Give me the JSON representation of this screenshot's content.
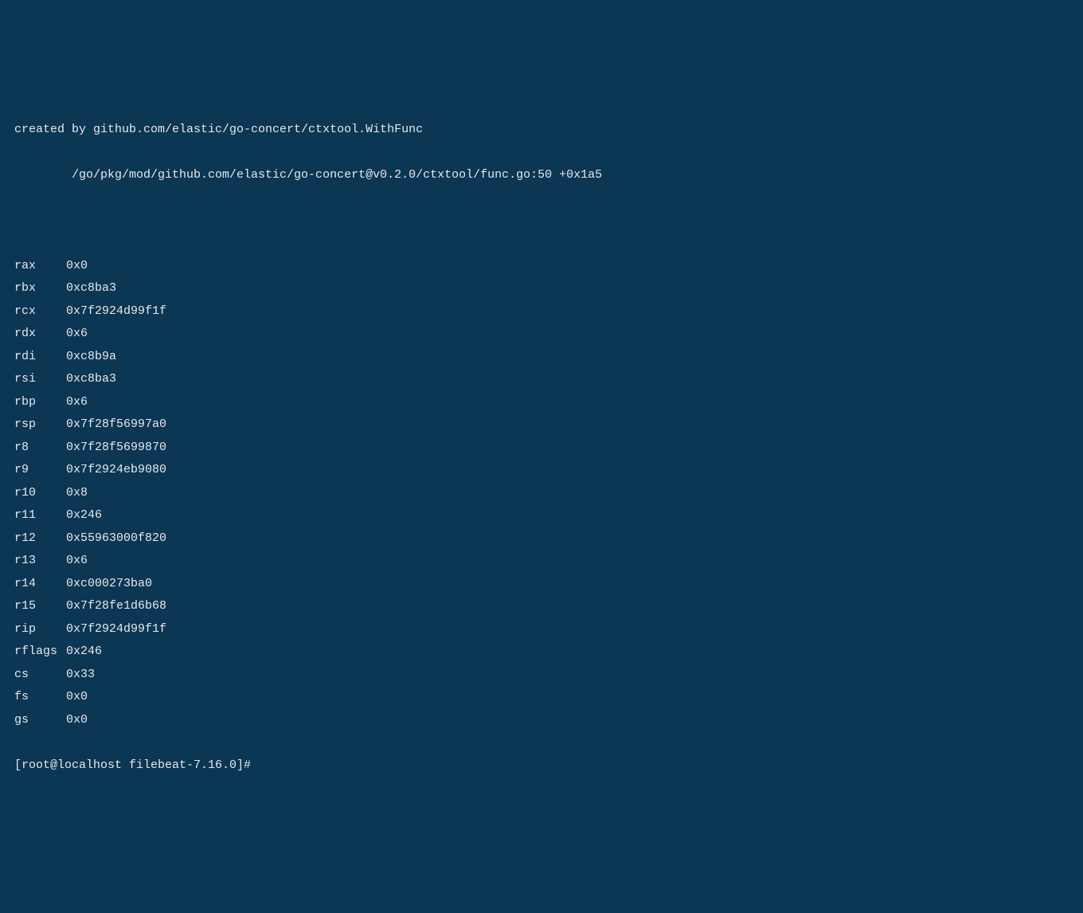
{
  "trace": {
    "line1": "created by github.com/elastic/go-concert/ctxtool.WithFunc",
    "line2": "        /go/pkg/mod/github.com/elastic/go-concert@v0.2.0/ctxtool/func.go:50 +0x1a5"
  },
  "registers": [
    {
      "name": "rax",
      "value": "0x0"
    },
    {
      "name": "rbx",
      "value": "0xc8ba3"
    },
    {
      "name": "rcx",
      "value": "0x7f2924d99f1f"
    },
    {
      "name": "rdx",
      "value": "0x6"
    },
    {
      "name": "rdi",
      "value": "0xc8b9a"
    },
    {
      "name": "rsi",
      "value": "0xc8ba3"
    },
    {
      "name": "rbp",
      "value": "0x6"
    },
    {
      "name": "rsp",
      "value": "0x7f28f56997a0"
    },
    {
      "name": "r8",
      "value": "0x7f28f5699870"
    },
    {
      "name": "r9",
      "value": "0x7f2924eb9080"
    },
    {
      "name": "r10",
      "value": "0x8"
    },
    {
      "name": "r11",
      "value": "0x246"
    },
    {
      "name": "r12",
      "value": "0x55963000f820"
    },
    {
      "name": "r13",
      "value": "0x6"
    },
    {
      "name": "r14",
      "value": "0xc000273ba0"
    },
    {
      "name": "r15",
      "value": "0x7f28fe1d6b68"
    },
    {
      "name": "rip",
      "value": "0x7f2924d99f1f"
    },
    {
      "name": "rflags",
      "value": "0x246"
    },
    {
      "name": "cs",
      "value": "0x33"
    },
    {
      "name": "fs",
      "value": "0x0"
    },
    {
      "name": "gs",
      "value": "0x0"
    }
  ],
  "prompt": "[root@localhost filebeat-7.16.0]#"
}
